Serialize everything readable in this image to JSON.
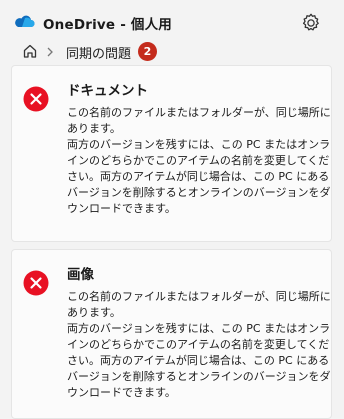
{
  "header": {
    "title": "OneDrive - 個人用",
    "cloud_icon": "cloud-icon",
    "settings_icon": "gear-icon"
  },
  "breadcrumb": {
    "home_icon": "home-icon",
    "separator_icon": "chevron-right-icon",
    "current": "同期の問題",
    "count": "2"
  },
  "issues": [
    {
      "title": "ドキュメント",
      "message": "この名前のファイルまたはフォルダーが、同じ場所にあります。\n両方のバージョンを残すには、この PC またはオンラインのどちらかでこのアイテムの名前を変更してください。両方のアイテムが同じ場合は、この PC にあるバージョンを削除するとオンラインのバージョンをダウンロードできます。"
    },
    {
      "title": "画像",
      "message": "この名前のファイルまたはフォルダーが、同じ場所にあります。\n両方のバージョンを残すには、この PC またはオンラインのどちらかでこのアイテムの名前を変更してください。両方のアイテムが同じ場合は、この PC にあるバージョンを削除するとオンラインのバージョンをダウンロードできます。"
    }
  ],
  "colors": {
    "background": "#f3f3f3",
    "card": "#fbfbfb",
    "error": "#e81123",
    "badge": "#c42b1c",
    "onedrive_blue": "#0f6cbd"
  }
}
